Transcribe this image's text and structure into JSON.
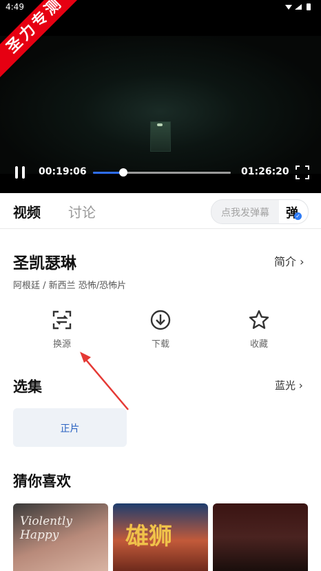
{
  "status_bar": {
    "time": "4:49",
    "icons": "▾◢▮"
  },
  "player": {
    "watermark": "圣力专测",
    "current_time": "00:19:06",
    "total_time": "01:26:20",
    "progress_fraction": 0.22
  },
  "tabs": {
    "video": "视频",
    "discuss": "讨论"
  },
  "danmu": {
    "placeholder": "点我发弹幕",
    "button": "弹",
    "check": "✓"
  },
  "movie": {
    "title": "圣凯瑟琳",
    "intro_label": "简介 ›",
    "meta": "阿根廷 / 新西兰  恐怖/恐怖片"
  },
  "actions": [
    {
      "label": "换源",
      "icon": "switch-source-icon"
    },
    {
      "label": "下载",
      "icon": "download-icon"
    },
    {
      "label": "收藏",
      "icon": "star-icon"
    }
  ],
  "episodes": {
    "title": "选集",
    "quality": "蓝光 ›",
    "items": [
      {
        "label": "正片"
      }
    ]
  },
  "recommend": {
    "title": "猜你喜欢",
    "posters": [
      {
        "text": "Violently Happy"
      },
      {
        "text": "雄狮"
      },
      {
        "text": ""
      }
    ]
  },
  "colors": {
    "accent": "#2f6df6",
    "ribbon": "#e60012",
    "episode_text": "#2a63c2"
  }
}
